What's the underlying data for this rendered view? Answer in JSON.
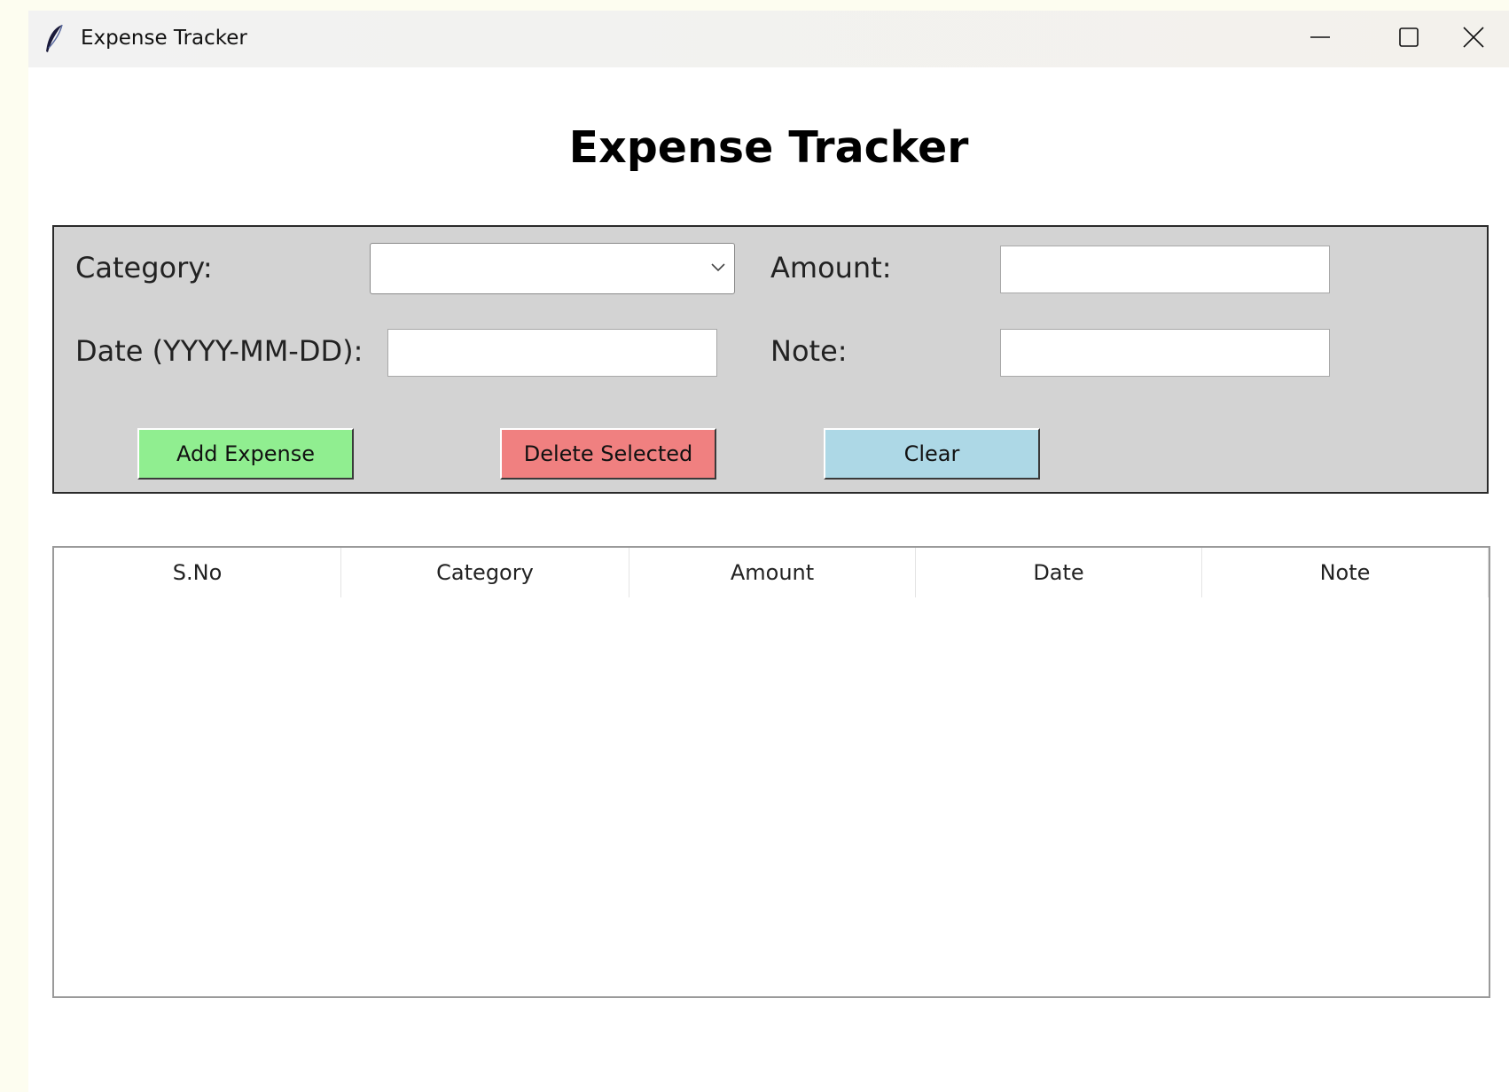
{
  "window": {
    "title": "Expense Tracker",
    "controls": {
      "minimize_icon": "minimize-icon",
      "maximize_icon": "maximize-icon",
      "close_icon": "close-icon"
    }
  },
  "heading": "Expense Tracker",
  "form": {
    "category_label": "Category:",
    "category_value": "",
    "amount_label": "Amount:",
    "amount_value": "",
    "date_label": "Date (YYYY-MM-DD):",
    "date_value": "",
    "note_label": "Note:",
    "note_value": ""
  },
  "buttons": {
    "add_label": "Add Expense",
    "delete_label": "Delete Selected",
    "clear_label": "Clear"
  },
  "table": {
    "columns": [
      "S.No",
      "Category",
      "Amount",
      "Date",
      "Note"
    ],
    "rows": []
  },
  "colors": {
    "form_background": "#d3d3d3",
    "add_button": "#90ee90",
    "delete_button": "#f08080",
    "clear_button": "#add8e6"
  }
}
